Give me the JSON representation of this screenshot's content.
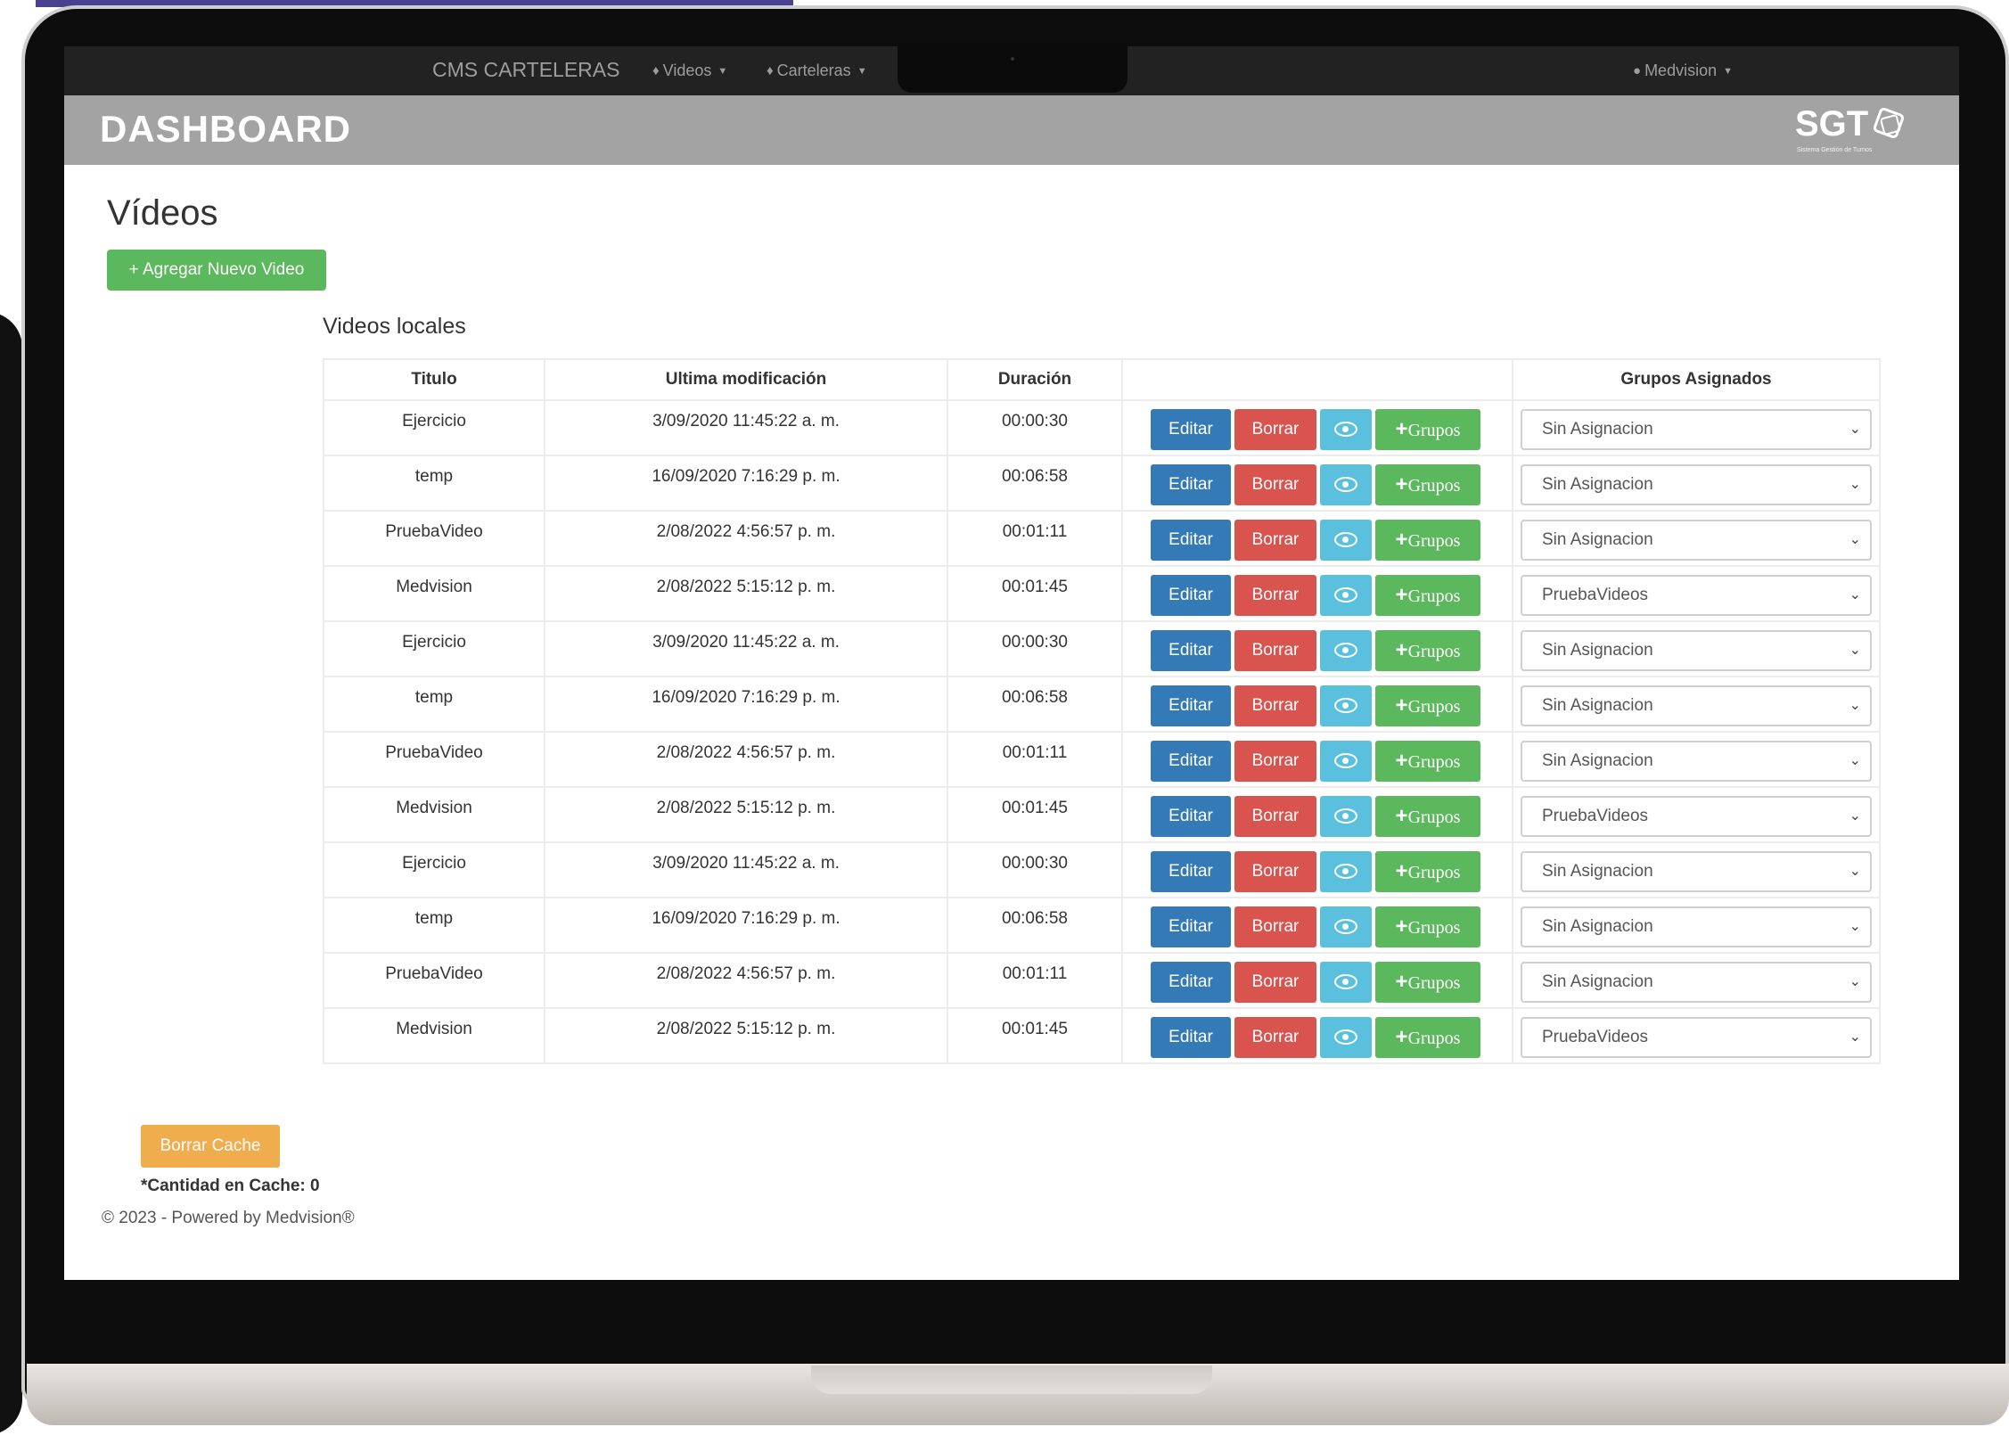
{
  "nav": {
    "brand": "CMS CARTELERAS",
    "items": [
      {
        "label": "Videos",
        "icon": "tag-icon"
      },
      {
        "label": "Carteleras",
        "icon": "tags-icon"
      }
    ],
    "user": "Medvision"
  },
  "header": {
    "title": "DASHBOARD",
    "logo_text": "SGT",
    "logo_sub": "Sistema Gestión de Turnos"
  },
  "page": {
    "title": "Vídeos",
    "add_button": "+ Agregar Nuevo Video",
    "section_title": "Videos locales"
  },
  "table": {
    "headers": [
      "Titulo",
      "Ultima modificación",
      "Duración",
      "",
      "Grupos Asignados"
    ],
    "actions": {
      "edit": "Editar",
      "delete": "Borrar",
      "groups_plus": "+",
      "groups": "Grupos"
    },
    "rows": [
      {
        "title": "Ejercicio",
        "modified": "3/09/2020 11:45:22 a. m.",
        "duration": "00:00:30",
        "group": "Sin Asignacion"
      },
      {
        "title": "temp",
        "modified": "16/09/2020 7:16:29 p. m.",
        "duration": "00:06:58",
        "group": "Sin Asignacion"
      },
      {
        "title": "PruebaVideo",
        "modified": "2/08/2022 4:56:57 p. m.",
        "duration": "00:01:11",
        "group": "Sin Asignacion"
      },
      {
        "title": "Medvision",
        "modified": "2/08/2022 5:15:12 p. m.",
        "duration": "00:01:45",
        "group": "PruebaVideos"
      },
      {
        "title": "Ejercicio",
        "modified": "3/09/2020 11:45:22 a. m.",
        "duration": "00:00:30",
        "group": "Sin Asignacion"
      },
      {
        "title": "temp",
        "modified": "16/09/2020 7:16:29 p. m.",
        "duration": "00:06:58",
        "group": "Sin Asignacion"
      },
      {
        "title": "PruebaVideo",
        "modified": "2/08/2022 4:56:57 p. m.",
        "duration": "00:01:11",
        "group": "Sin Asignacion"
      },
      {
        "title": "Medvision",
        "modified": "2/08/2022 5:15:12 p. m.",
        "duration": "00:01:45",
        "group": "PruebaVideos"
      },
      {
        "title": "Ejercicio",
        "modified": "3/09/2020 11:45:22 a. m.",
        "duration": "00:00:30",
        "group": "Sin Asignacion"
      },
      {
        "title": "temp",
        "modified": "16/09/2020 7:16:29 p. m.",
        "duration": "00:06:58",
        "group": "Sin Asignacion"
      },
      {
        "title": "PruebaVideo",
        "modified": "2/08/2022 4:56:57 p. m.",
        "duration": "00:01:11",
        "group": "Sin Asignacion"
      },
      {
        "title": "Medvision",
        "modified": "2/08/2022 5:15:12 p. m.",
        "duration": "00:01:45",
        "group": "PruebaVideos"
      }
    ]
  },
  "cache": {
    "button": "Borrar Cache",
    "count_text": "*Cantidad en Cache: 0"
  },
  "footer": {
    "text": "© 2023 - Powered by Medvision®"
  },
  "colors": {
    "navbar": "#222222",
    "header": "#a3a3a3",
    "primary": "#337ab7",
    "danger": "#d9534f",
    "info": "#5bc0de",
    "success": "#5cb85c",
    "warning": "#f0ad4e"
  }
}
